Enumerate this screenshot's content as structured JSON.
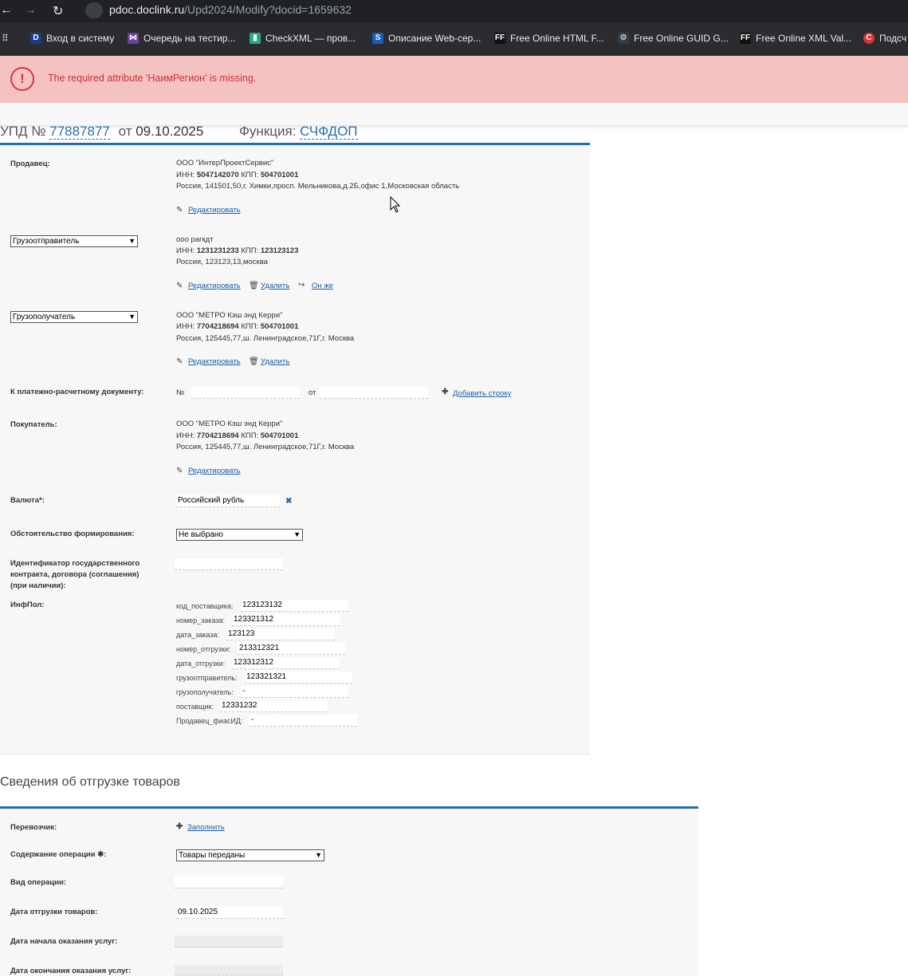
{
  "browser": {
    "url_domain": "pdoc.doclink.ru",
    "url_path": "/Upd2024/Modify?docid=1659632",
    "bookmarks": [
      {
        "label": "Вход в систему",
        "icon": "D"
      },
      {
        "label": "Очередь на тестир...",
        "icon": "VS"
      },
      {
        "label": "CheckXML — пров...",
        "icon": "C"
      },
      {
        "label": "Описание Web-сер...",
        "icon": "S"
      },
      {
        "label": "Free Online HTML F...",
        "icon": "FF"
      },
      {
        "label": "Free Online GUID G...",
        "icon": "gear"
      },
      {
        "label": "Free Online XML Val...",
        "icon": "FF"
      },
      {
        "label": "Подсч",
        "icon": "C"
      }
    ]
  },
  "error": {
    "message": "The required attribute 'НаимРегион' is missing."
  },
  "header": {
    "doc_prefix": "УПД №",
    "doc_number": "77887877",
    "from_label": "от",
    "doc_date": "09.10.2025",
    "function_label": "Функция:",
    "function_value": "СЧФДОП"
  },
  "seller": {
    "label": "Продавец:",
    "name": "ООО \"ИнтерПроектСервис\"",
    "inn_prefix": "ИНН:",
    "inn": "5047142070",
    "kpp_prefix": "КПП:",
    "kpp": "504701001",
    "address": "Россия, 141501,50,г. Химки,просп. Мельникова,д.2Б,офис 1,Московская область",
    "edit": "Редактировать"
  },
  "shipper": {
    "select": "Грузоотправитель",
    "name": "ооо рагкдт",
    "inn_prefix": "ИНН:",
    "inn": "1231231233",
    "kpp_prefix": "КПП:",
    "kpp": "123123123",
    "address": "Россия, 123123,13,москва",
    "edit": "Редактировать",
    "delete": "Удалить",
    "same": "Он же"
  },
  "consignee": {
    "select": "Грузополучатель",
    "name": "ООО \"МЕТРО Кэш энд Керри\"",
    "inn_prefix": "ИНН:",
    "inn": "7704218694",
    "kpp_prefix": "КПП:",
    "kpp": "504701001",
    "address": "Россия, 125445,77,ш. Ленинградское,71Г,г. Москва",
    "edit": "Редактировать",
    "delete": "Удалить"
  },
  "payment_doc": {
    "label": "К платежно-расчетному документу:",
    "number_label": "№",
    "from_label": "от",
    "add_row": "Добавить строку"
  },
  "buyer": {
    "label": "Покупатель:",
    "name": "ООО \"МЕТРО Кэш энд Керри\"",
    "inn_prefix": "ИНН:",
    "inn": "7704218694",
    "kpp_prefix": "КПП:",
    "kpp": "504701001",
    "address": "Россия, 125445,77,ш. Ленинградское,71Г,г. Москва",
    "edit": "Редактировать"
  },
  "currency": {
    "label": "Валюта*:",
    "value": "Российский рубль"
  },
  "circumstance": {
    "label": "Обстоятельство формирования:",
    "value": "Не выбрано"
  },
  "gov_contract": {
    "label": "Идентификатор государственного контракта, договора (соглашения) (при наличии):"
  },
  "infpol": {
    "label": "ИнфПол:",
    "items": [
      {
        "key": "код_поставщика:",
        "value": "123123132"
      },
      {
        "key": "номер_заказа:",
        "value": "123321312"
      },
      {
        "key": "дата_заказа:",
        "value": "123123"
      },
      {
        "key": "номер_отгрузки:",
        "value": "213312321"
      },
      {
        "key": "дата_отгрузки:",
        "value": "123312312"
      },
      {
        "key": "грузоотправитель:",
        "value": "123321321"
      },
      {
        "key": "грузополучатель:",
        "value": "-"
      },
      {
        "key": "поставщик:",
        "value": "12331232"
      },
      {
        "key": "Продавец_фиасИД:",
        "value": "-"
      }
    ]
  },
  "shipment": {
    "title": "Сведения об отгрузке товаров",
    "carrier_label": "Перевозчик:",
    "carrier_fill": "Заполнить",
    "operation_label": "Содержание операции",
    "operation_value": "Товары переданы",
    "op_type_label": "Вид операции:",
    "ship_date_label": "Дата отгрузки товаров:",
    "ship_date_value": "09.10.2025",
    "service_start_label": "Дата начала оказания услуг:",
    "service_end_label": "Дата окончания оказания услуг:"
  },
  "colors": {
    "accent": "#1f6fb5",
    "error_bg": "#f5c2c2",
    "error_text": "#c8323a",
    "link": "#1a5fa8"
  }
}
